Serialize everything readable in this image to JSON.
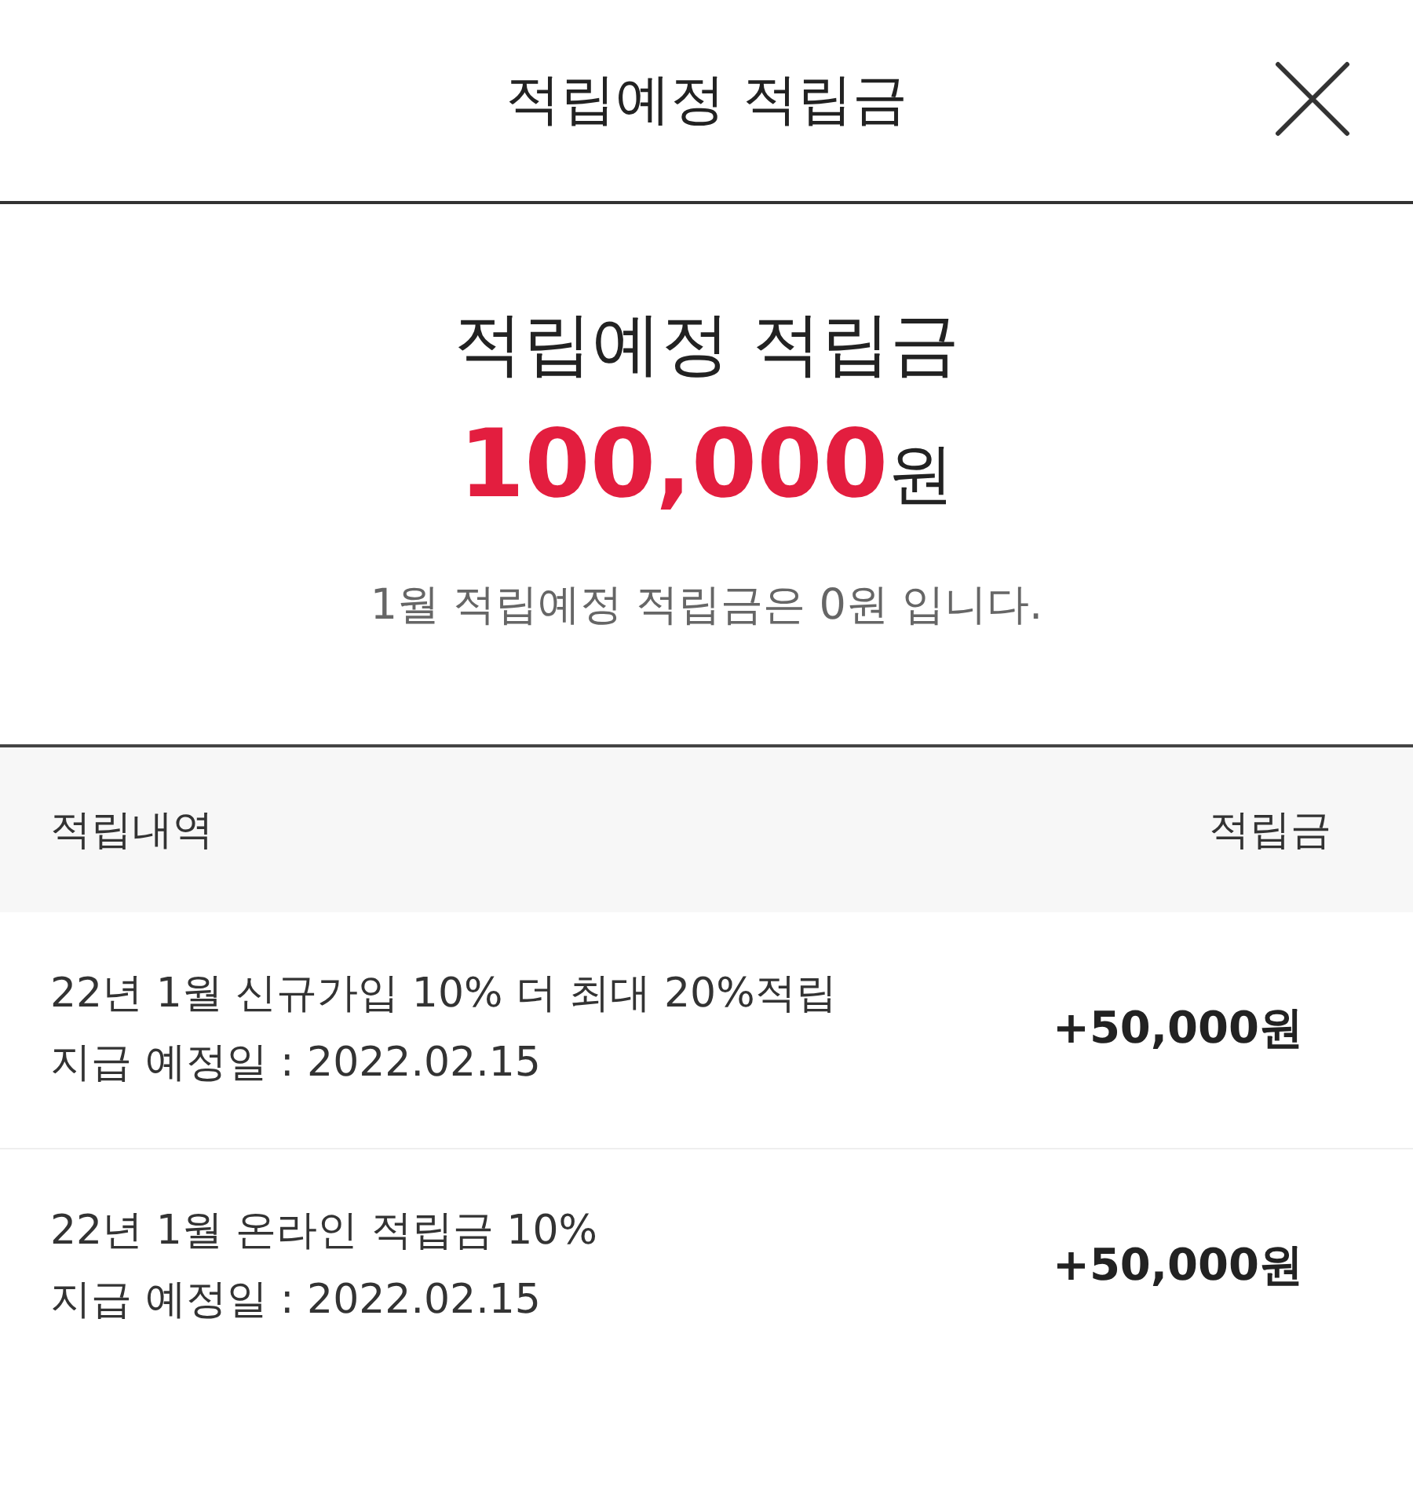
{
  "header": {
    "title": "적립예정 적립금"
  },
  "summary": {
    "title": "적립예정 적립금",
    "amount": {
      "value": "100,000",
      "unit": "원"
    },
    "note": "1월 적립예정 적립금은 0원 입니다."
  },
  "table": {
    "columns": [
      "적립내역",
      "적립금"
    ],
    "rows": [
      {
        "title": "22년 1월 신규가입 10% 더 최대 20%적립",
        "date": "지급 예정일 : 2022.02.15",
        "amount": "+50,000원"
      },
      {
        "title": "22년 1월 온라인 적립금 10%",
        "date": "지급 예정일 : 2022.02.15",
        "amount": "+50,000원"
      }
    ]
  }
}
